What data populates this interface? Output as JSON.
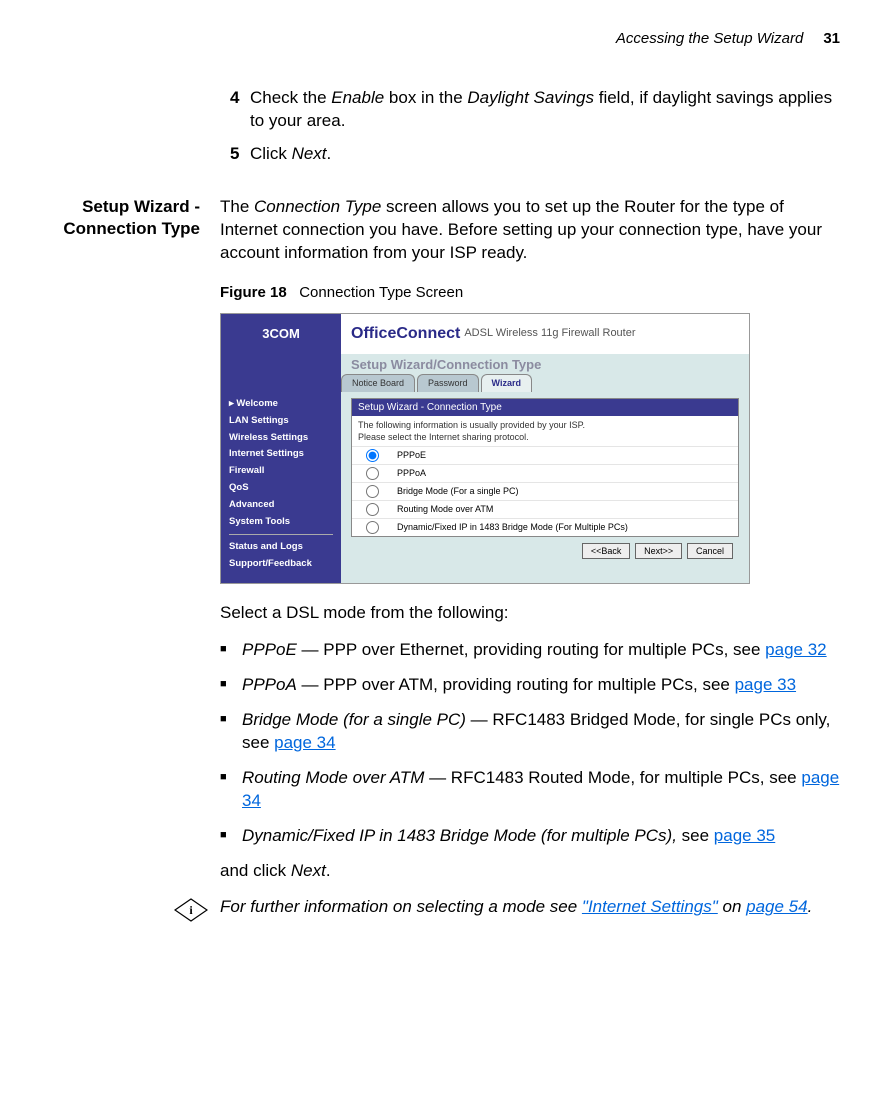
{
  "header": {
    "running_head": "Accessing the Setup Wizard",
    "page_num": "31"
  },
  "steps": {
    "s4_num": "4",
    "s4_text_a": "Check the ",
    "s4_text_b": "Enable",
    "s4_text_c": " box in the ",
    "s4_text_d": "Daylight Savings",
    "s4_text_e": " field, if daylight savings applies to your area.",
    "s5_num": "5",
    "s5_text_a": "Click ",
    "s5_text_b": "Next",
    "s5_text_c": "."
  },
  "section_label_a": "Setup Wizard -",
  "section_label_b": "Connection Type",
  "section_intro_a": "The ",
  "section_intro_b": "Connection Type",
  "section_intro_c": " screen allows you to set up the Router for the type of Internet connection you have. Before setting up your connection type, have your account information from your ISP ready.",
  "figcap_label": "Figure 18",
  "figcap_text": "Connection Type Screen",
  "shot": {
    "logo": "3COM",
    "brand": "OfficeConnect",
    "brand_sub": "ADSL Wireless 11g Firewall Router",
    "subtitle": "Setup Wizard/Connection Type",
    "tabs": {
      "t1": "Notice Board",
      "t2": "Password",
      "t3": "Wizard"
    },
    "nav": [
      "Welcome",
      "LAN Settings",
      "Wireless Settings",
      "Internet Settings",
      "Firewall",
      "QoS",
      "Advanced",
      "System Tools",
      "Status and Logs",
      "Support/Feedback"
    ],
    "panel_head": "Setup Wizard - Connection Type",
    "panel_info1": "The following information is usually provided by your ISP.",
    "panel_info2": "Please select the Internet sharing protocol.",
    "opts": [
      "PPPoE",
      "PPPoA",
      "Bridge Mode (For a single PC)",
      "Routing Mode over ATM",
      "Dynamic/Fixed IP in 1483 Bridge Mode (For Multiple PCs)"
    ],
    "btns": {
      "back": "<<Back",
      "next": "Next>>",
      "cancel": "Cancel"
    }
  },
  "dsl_intro": "Select a DSL mode from the following:",
  "dsl": {
    "i1a": "PPPoE",
    "i1b": " — PPP over Ethernet, providing routing for multiple PCs, see ",
    "i1c": "page 32",
    "i2a": "PPPoA",
    "i2b": " — PPP over ATM, providing routing for multiple PCs, see ",
    "i2c": "page 33",
    "i3a": "Bridge Mode (for a single PC)",
    "i3b": " — RFC1483 Bridged Mode, for single PCs only, see ",
    "i3c": "page 34",
    "i4a": "Routing Mode over ATM",
    "i4b": " — RFC1483 Routed Mode, for multiple PCs, see ",
    "i4c": "page 34",
    "i5a": "Dynamic/Fixed IP in 1483 Bridge Mode (for multiple PCs),",
    "i5b": " see ",
    "i5c": "page 35"
  },
  "after_list_a": "and click ",
  "after_list_b": "Next",
  "after_list_c": ".",
  "note_a": "For further information on selecting a mode see ",
  "note_b": "\"Internet Settings\"",
  "note_c": " on ",
  "note_d": "page 54",
  "note_e": "."
}
